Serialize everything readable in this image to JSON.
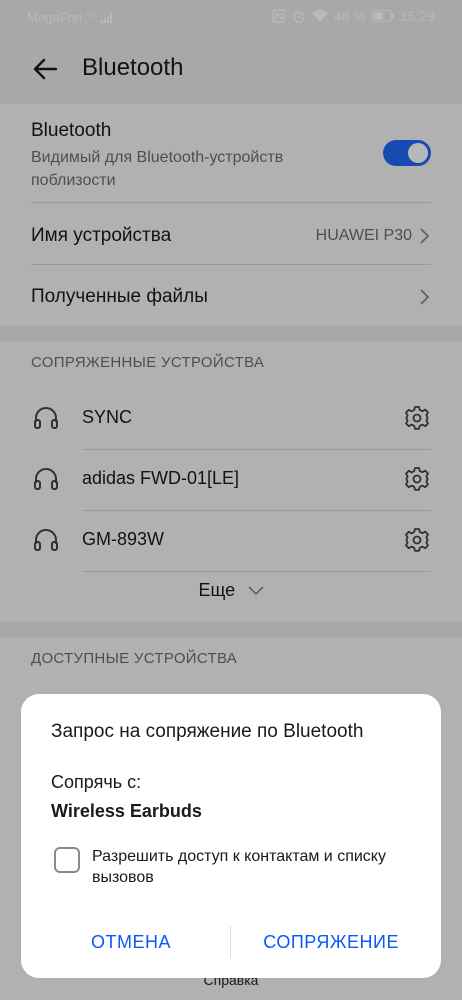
{
  "status_bar": {
    "carrier": "MegaFon",
    "network": "4G",
    "battery": "48 %",
    "time": "15:29"
  },
  "toolbar": {
    "title": "Bluetooth"
  },
  "bluetooth": {
    "title": "Bluetooth",
    "description": "Видимый для Bluetooth-устройств поблизости",
    "enabled": true
  },
  "device_name": {
    "label": "Имя устройства",
    "value": "HUAWEI P30"
  },
  "received_files": {
    "label": "Полученные файлы"
  },
  "paired": {
    "header": "СОПРЯЖЕННЫЕ УСТРОЙСТВА",
    "devices": [
      {
        "name": "SYNC"
      },
      {
        "name": "adidas FWD-01[LE]"
      },
      {
        "name": "GM-893W"
      }
    ],
    "more_label": "Еще"
  },
  "available": {
    "header": "ДОСТУПНЫЕ УСТРОЙСТВА"
  },
  "footer": {
    "help_label": "Справка"
  },
  "dialog": {
    "title": "Запрос на сопряжение по Bluetooth",
    "pair_with_label": "Сопрячь с:",
    "device_name": "Wireless Earbuds",
    "checkbox_label": "Разрешить доступ к контактам и списку вызовов",
    "checkbox_checked": false,
    "cancel_label": "ОТМЕНА",
    "pair_label": "СОПРЯЖЕНИЕ"
  },
  "colors": {
    "accent": "#0a59f7",
    "background": "#e9e9e9",
    "card": "#f6f6f6"
  }
}
